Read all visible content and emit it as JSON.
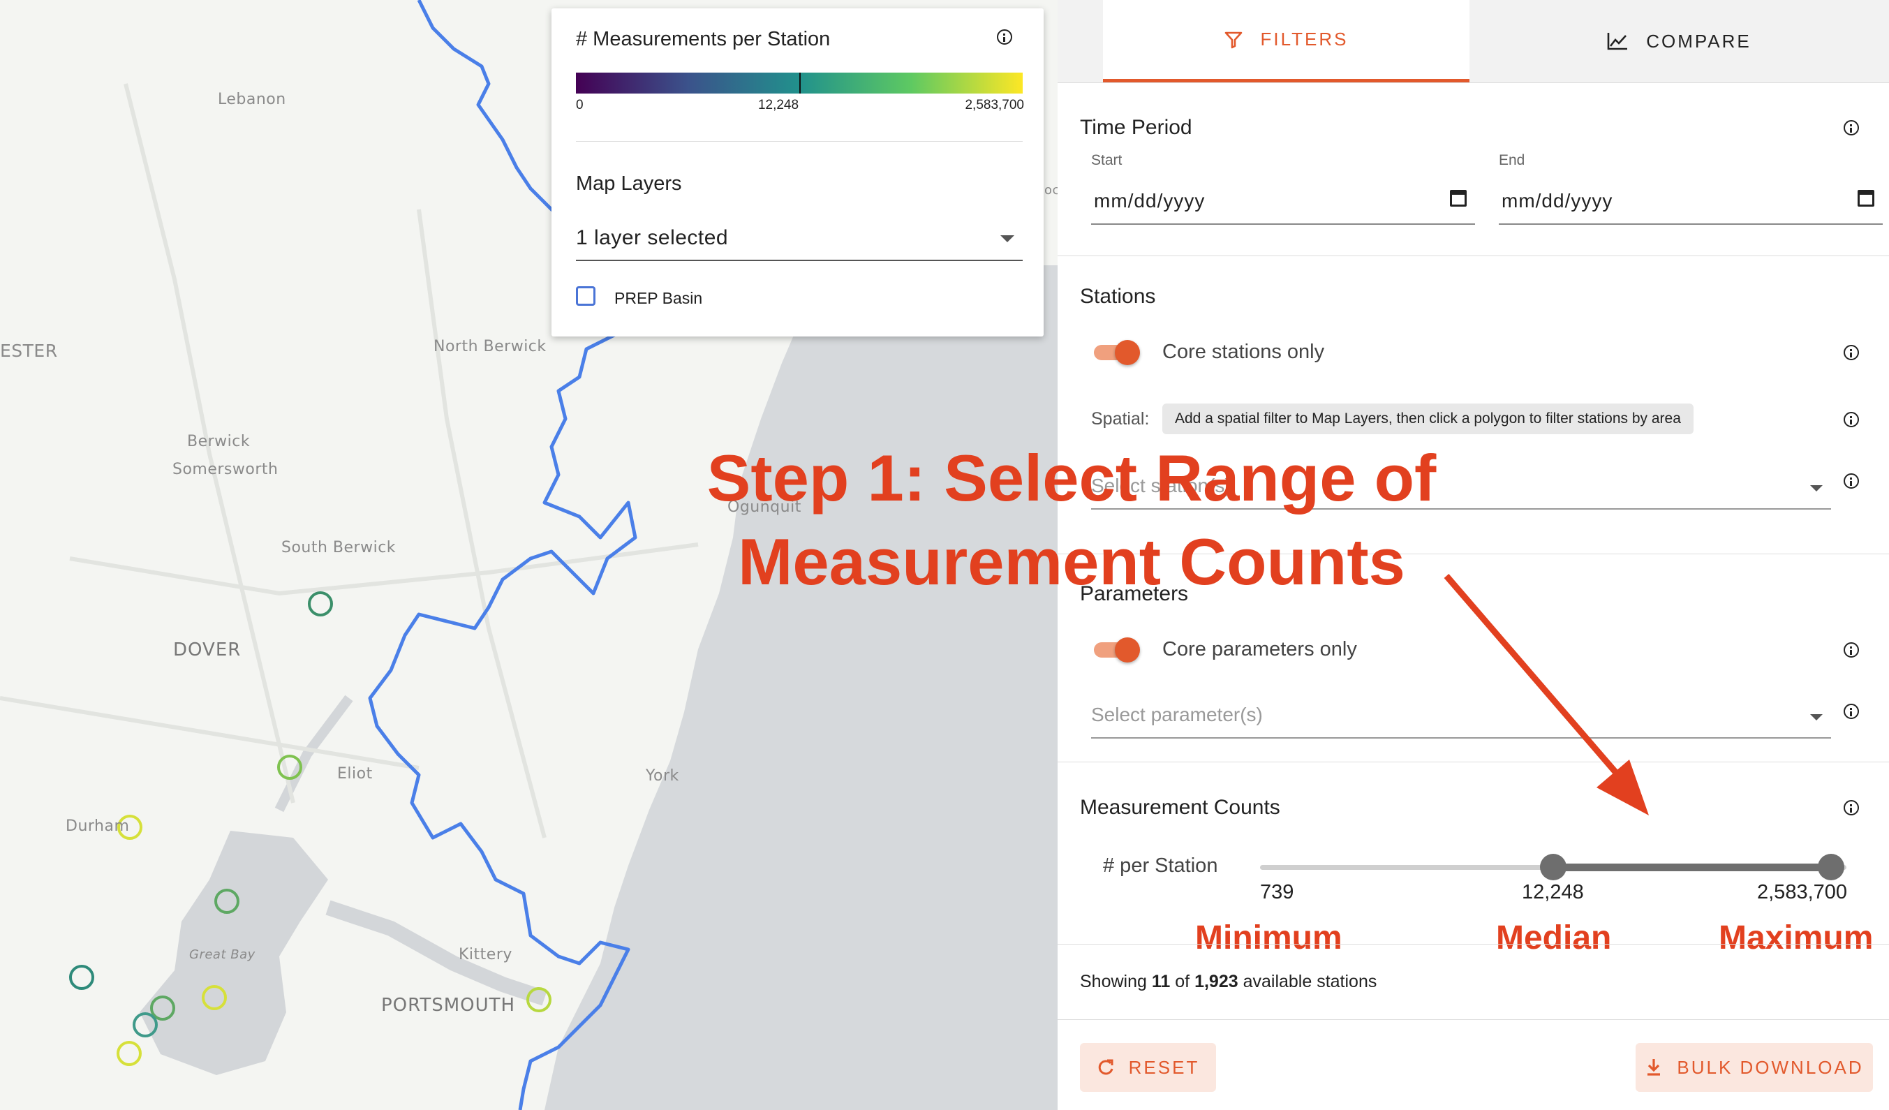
{
  "legend": {
    "title": "# Measurements per Station",
    "colorbar_ticks": [
      "0",
      "12,248",
      "2,583,700"
    ],
    "colorbar_colors": [
      "#440154",
      "#3b528b",
      "#21918c",
      "#5ec962",
      "#fde725"
    ],
    "map_layers_label": "Map Layers",
    "layers_selected": "1 layer selected",
    "layer_option": "PREP Basin",
    "layer_option_checked": false
  },
  "map": {
    "labels": [
      "Lebanon",
      "ESTER",
      "North Berwick",
      "Berwick",
      "Somersworth",
      "South Berwick",
      "Ogunquit",
      "DOVER",
      "Eliot",
      "York",
      "Durham",
      "Great Bay",
      "Kittery",
      "PORTSMOUTH",
      "oc"
    ],
    "basin_color": "#4a7fe8",
    "station_colors": [
      "#3b8f6a",
      "#7fc250",
      "#d6e03a",
      "#3f9a8a",
      "#2e8a7a"
    ]
  },
  "tabs": {
    "filters": "FILTERS",
    "compare": "COMPARE",
    "active": "filters",
    "accent_color": "#e2592c"
  },
  "time_period": {
    "title": "Time Period",
    "start_label": "Start",
    "start_value": "mm/dd/yyyy",
    "end_label": "End",
    "end_value": "mm/dd/yyyy"
  },
  "stations": {
    "title": "Stations",
    "core_only_label": "Core stations only",
    "core_only_on": true,
    "spatial_label": "Spatial:",
    "spatial_chip": "Add a spatial filter to Map Layers, then click a polygon to filter stations by area",
    "select_placeholder": "Select station(s)"
  },
  "parameters": {
    "title": "Parameters",
    "core_only_label": "Core parameters only",
    "core_only_on": true,
    "select_placeholder": "Select parameter(s)"
  },
  "measurement_counts": {
    "title": "Measurement Counts",
    "per_station_label": "# per Station",
    "min_value": "739",
    "median_value": "12,248",
    "max_value": "2,583,700",
    "selected_range": [
      "12,248",
      "2,583,700"
    ]
  },
  "annotations": {
    "headline_line1": "Step 1: Select Range of",
    "headline_line2": "Measurement Counts",
    "minimum": "Minimum",
    "median": "Median",
    "maximum": "Maximum"
  },
  "status": {
    "prefix": "Showing",
    "shown": "11",
    "of": "of",
    "total": "1,923",
    "suffix": "available stations"
  },
  "buttons": {
    "reset": "RESET",
    "bulk_download": "BULK DOWNLOAD"
  }
}
